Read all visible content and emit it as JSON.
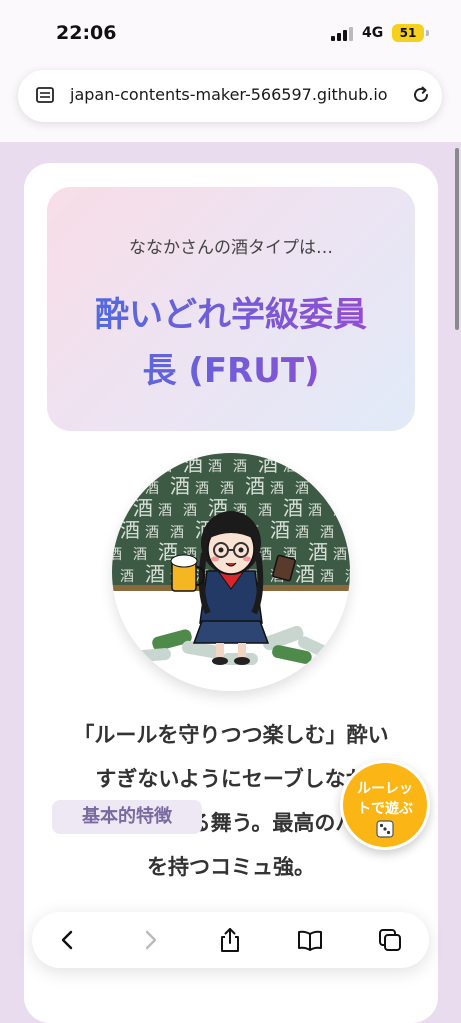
{
  "status_bar": {
    "time": "22:06",
    "network": "4G",
    "battery": "51"
  },
  "browser": {
    "url": "japan-contents-maker-566597.github.io",
    "page_icon": "page-icon",
    "reload_icon": "reload-icon"
  },
  "result": {
    "subtitle": "ななかさんの酒タイプは…",
    "title_line1": "酔いどれ学級委員",
    "title_line2": "長 (FRUT)",
    "title_gradient": [
      "#4b6ee0",
      "#9b4ad1"
    ]
  },
  "illustration": {
    "board_kanji": "酒"
  },
  "description": {
    "line1": "「ルールを守りつつ楽しむ」酔い",
    "line2": "すぎないようにセーブしなが",
    "line3": "明るく振る舞う。最高のバ",
    "line4": "を持つコミュ強。"
  },
  "feature_heading": "基本的特徴",
  "roulette": {
    "line1": "ルーレッ",
    "line2": "トで遊ぶ",
    "icon": "dice-icon",
    "color": "#fbb515"
  },
  "toolbar": {
    "back_icon": "chevron-left-icon",
    "forward_icon": "chevron-right-icon",
    "share_icon": "share-icon",
    "bookmarks_icon": "book-icon",
    "tabs_icon": "tabs-icon"
  }
}
